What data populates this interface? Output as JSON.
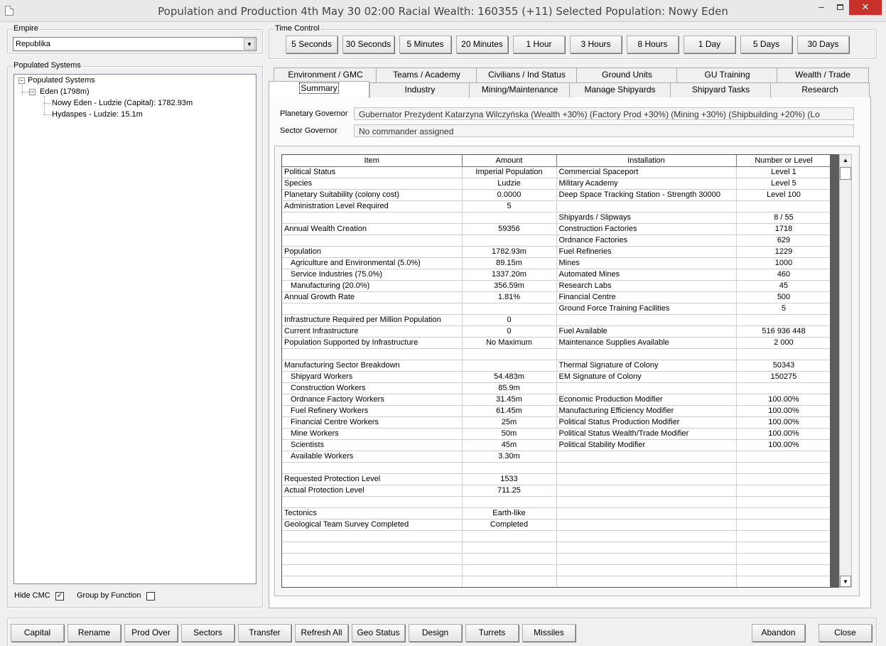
{
  "window": {
    "title": "Population and Production  4th May 30 02:00    Racial Wealth: 160355 (+11)    Selected Population: Nowy Eden",
    "minimize": "–",
    "close": "✕"
  },
  "empire": {
    "label": "Empire",
    "selected": "Republika"
  },
  "time_control": {
    "label": "Time Control",
    "buttons": [
      "5 Seconds",
      "30 Seconds",
      "5 Minutes",
      "20 Minutes",
      "1 Hour",
      "3 Hours",
      "8 Hours",
      "1 Day",
      "5 Days",
      "30 Days"
    ]
  },
  "populated_systems": {
    "label": "Populated Systems",
    "root": "Populated Systems",
    "system": "Eden (1798m)",
    "colonies": [
      "Nowy Eden - Ludzie (Capital): 1782.93m",
      "Hydaspes - Ludzie: 15.1m"
    ]
  },
  "options": {
    "hide_cmc": "Hide CMC",
    "hide_cmc_checked": "✓",
    "group_by_function": "Group by Function",
    "group_by_function_checked": ""
  },
  "tabs": {
    "row_top": [
      "Environment / GMC",
      "Teams / Academy",
      "Civilians / Ind Status",
      "Ground Units",
      "GU Training",
      "Wealth / Trade"
    ],
    "row_bottom": [
      "Summary",
      "Industry",
      "Mining/Maintenance",
      "Manage Shipyards",
      "Shipyard Tasks",
      "Research"
    ],
    "active": "Summary"
  },
  "governors": {
    "planetary_label": "Planetary Governor",
    "planetary_value": "Gubernator Prezydent Katarzyna Wilczyńska  (Wealth +30%)  (Factory Prod +30%)  (Mining +30%)  (Shipbuilding +20%)  (Lo",
    "sector_label": "Sector Governor",
    "sector_value": "No commander assigned"
  },
  "summary_table": {
    "headers": [
      "Item",
      "Amount",
      "Installation",
      "Number or Level"
    ],
    "rows": [
      [
        "Political Status",
        "Imperial Population",
        "Commercial Spaceport",
        "Level 1"
      ],
      [
        "Species",
        "Ludzie",
        "Military Academy",
        "Level 5"
      ],
      [
        "Planetary Suitability (colony cost)",
        "0.0000",
        "Deep Space Tracking Station - Strength 30000",
        "Level 100"
      ],
      [
        "Administration Level Required",
        "5",
        "",
        ""
      ],
      [
        "",
        "",
        "Shipyards / Slipways",
        "8 / 55"
      ],
      [
        "Annual Wealth Creation",
        "59356",
        "Construction Factories",
        "1718"
      ],
      [
        "",
        "",
        "Ordnance Factories",
        "629"
      ],
      [
        "Population",
        "1782.93m",
        "Fuel Refineries",
        "1229"
      ],
      [
        "   Agriculture and Environmental  (5.0%)",
        "89.15m",
        "Mines",
        "1000"
      ],
      [
        "   Service Industries  (75.0%)",
        "1337.20m",
        "Automated Mines",
        "460"
      ],
      [
        "   Manufacturing  (20.0%)",
        "356.59m",
        "Research Labs",
        "45"
      ],
      [
        "Annual Growth Rate",
        "1.81%",
        "Financial Centre",
        "500"
      ],
      [
        "",
        "",
        "Ground Force Training Facilities",
        "5"
      ],
      [
        "Infrastructure Required per Million Population",
        "0",
        "",
        ""
      ],
      [
        "Current Infrastructure",
        "0",
        "Fuel Available",
        "516 936 448"
      ],
      [
        "Population Supported by Infrastructure",
        "No Maximum",
        "Maintenance Supplies Available",
        "2 000"
      ],
      [
        "",
        "",
        "",
        ""
      ],
      [
        "Manufacturing Sector Breakdown",
        "",
        "Thermal Signature of Colony",
        "50343"
      ],
      [
        "   Shipyard Workers",
        "54.483m",
        "EM Signature of Colony",
        "150275"
      ],
      [
        "   Construction Workers",
        "85.9m",
        "",
        ""
      ],
      [
        "   Ordnance Factory Workers",
        "31.45m",
        "Economic Production Modifier",
        "100.00%"
      ],
      [
        "   Fuel Refinery Workers",
        "61.45m",
        "Manufacturing Efficiency Modifier",
        "100.00%"
      ],
      [
        "   Financial Centre Workers",
        "25m",
        "Political Status Production Modifier",
        "100.00%"
      ],
      [
        "   Mine Workers",
        "50m",
        "Political Status Wealth/Trade Modifier",
        "100.00%"
      ],
      [
        "   Scientists",
        "45m",
        "Political Stability Modifier",
        "100.00%"
      ],
      [
        "   Available Workers",
        "3.30m",
        "",
        ""
      ],
      [
        "",
        "",
        "",
        ""
      ],
      [
        "Requested Protection Level",
        "1533",
        "",
        ""
      ],
      [
        "Actual Protection Level",
        "711.25",
        "",
        ""
      ],
      [
        "",
        "",
        "",
        ""
      ],
      [
        "Tectonics",
        "Earth-like",
        "",
        ""
      ],
      [
        "Geological Team Survey Completed",
        "Completed",
        "",
        ""
      ],
      [
        "",
        "",
        "",
        ""
      ],
      [
        "",
        "",
        "",
        ""
      ],
      [
        "",
        "",
        "",
        ""
      ],
      [
        "",
        "",
        "",
        ""
      ],
      [
        "",
        "",
        "",
        ""
      ]
    ]
  },
  "bottom_buttons": [
    "Capital",
    "Rename",
    "Prod Over",
    "Sectors",
    "Transfer",
    "Refresh All",
    "Geo Status",
    "Design",
    "Turrets",
    "Missiles"
  ],
  "bottom_right_buttons": [
    "Abandon",
    "Close"
  ]
}
